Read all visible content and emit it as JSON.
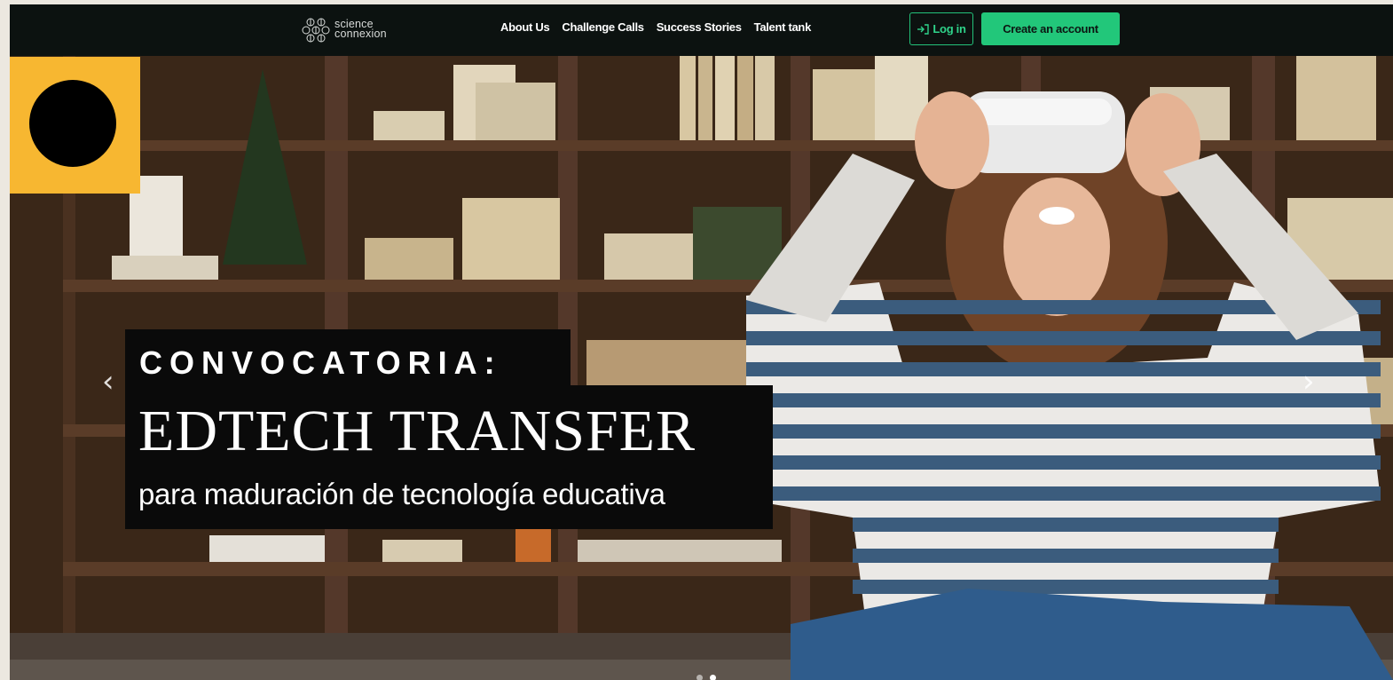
{
  "nav": {
    "logo": {
      "line1": "science",
      "line2": "connexion",
      "icon": "snowflake-cluster-icon"
    },
    "links": [
      "About Us",
      "Challenge Calls",
      "Success Stories",
      "Talent tank"
    ],
    "login_label": "Log in",
    "login_icon": "login-arrow-icon",
    "create_label": "Create an account"
  },
  "hero": {
    "kicker": "CONVOCATORIA:",
    "title": "EDTECH TRANSFER",
    "subtitle": "para maduración de tecnología educativa",
    "prev_icon": "chevron-left-icon",
    "next_icon": "chevron-right-icon",
    "slide_count": 2,
    "active_slide": 2
  },
  "colors": {
    "nav_bg": "#0c1210",
    "accent_green": "#22c77a",
    "badge_yellow": "#f7b731",
    "tag_black": "#0a0a0a"
  }
}
